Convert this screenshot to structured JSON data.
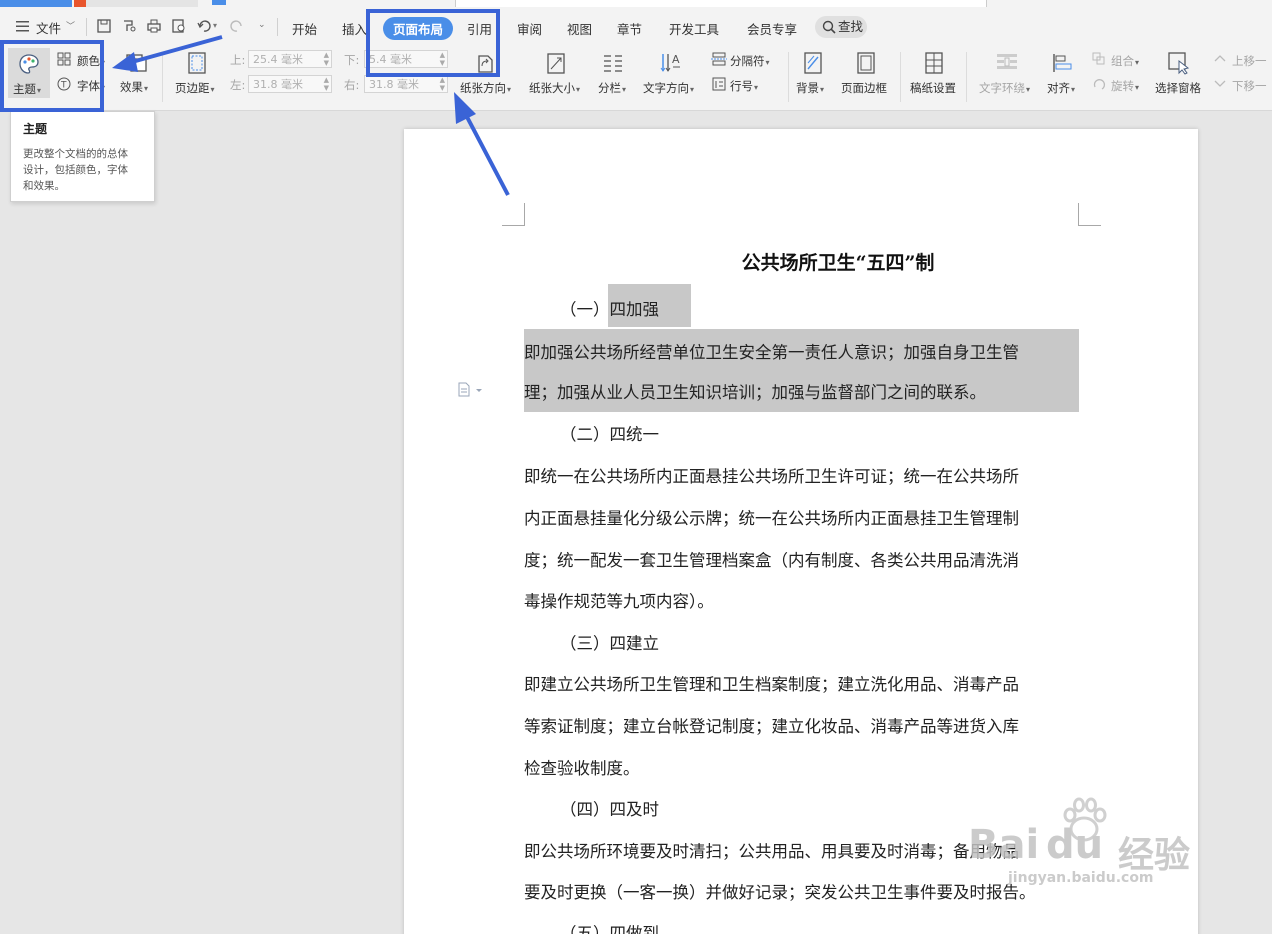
{
  "menu": {
    "file": "文件",
    "tabs": [
      "开始",
      "插入",
      "页面布局",
      "引用",
      "审阅",
      "视图",
      "章节",
      "开发工具",
      "会员专享"
    ],
    "active_tab": "页面布局",
    "search": "查找"
  },
  "ribbon": {
    "theme": "主题",
    "color": "颜色",
    "font": "字体",
    "effect": "效果",
    "margins": "页边距",
    "margin_top_label": "上:",
    "margin_top_value": "25.4 毫米",
    "margin_left_label": "左:",
    "margin_left_value": "31.8 毫米",
    "margin_bottom_label": "下:",
    "margin_bottom_value": "5.4 毫米",
    "margin_right_label": "右:",
    "margin_right_value": "31.8 毫米",
    "orientation": "纸张方向",
    "size": "纸张大小",
    "columns": "分栏",
    "text_direction": "文字方向",
    "separator": "分隔符",
    "line_number": "行号",
    "background": "背景",
    "page_border": "页面边框",
    "paper_setup": "稿纸设置",
    "text_wrap": "文字环绕",
    "align": "对齐",
    "group": "组合",
    "rotate": "旋转",
    "select_pane": "选择窗格",
    "move_up": "上移一",
    "move_down": "下移一"
  },
  "tooltip": {
    "title": "主题",
    "desc1": "更改整个文档的的总体",
    "desc2": "设计，包括颜色，字体",
    "desc3": "和效果。"
  },
  "document": {
    "title": "公共场所卫生“五四”制",
    "lines": [
      "（一）四加强",
      "即加强公共场所经营单位卫生安全第一责任人意识；加强自身卫生管",
      "理；加强从业人员卫生知识培训；加强与监督部门之间的联系。",
      "（二）四统一",
      "即统一在公共场所内正面悬挂公共场所卫生许可证；统一在公共场所",
      "内正面悬挂量化分级公示牌；统一在公共场所内正面悬挂卫生管理制",
      "度；统一配发一套卫生管理档案盒（内有制度、各类公共用品清洗消",
      "毒操作规范等九项内容）。",
      "（三）四建立",
      "即建立公共场所卫生管理和卫生档案制度；建立洗化用品、消毒产品",
      "等索证制度；建立台帐登记制度；建立化妆品、消毒产品等进货入库",
      "检查验收制度。",
      "（四）四及时",
      "即公共场所环境要及时清扫；公共用品、用具要及时消毒；备用物品",
      "要及时更换（一客一换）并做好记录；突发公共卫生事件要及时报告。",
      "（五）四做到"
    ]
  },
  "watermark": {
    "brand": "Bai",
    "brand2": "du",
    "cn": "经验",
    "url": "jingyan.baidu.com"
  },
  "colors": {
    "accent": "#4a8ee8",
    "annotation": "#3a63d6",
    "selection": "#c8c8c8"
  }
}
